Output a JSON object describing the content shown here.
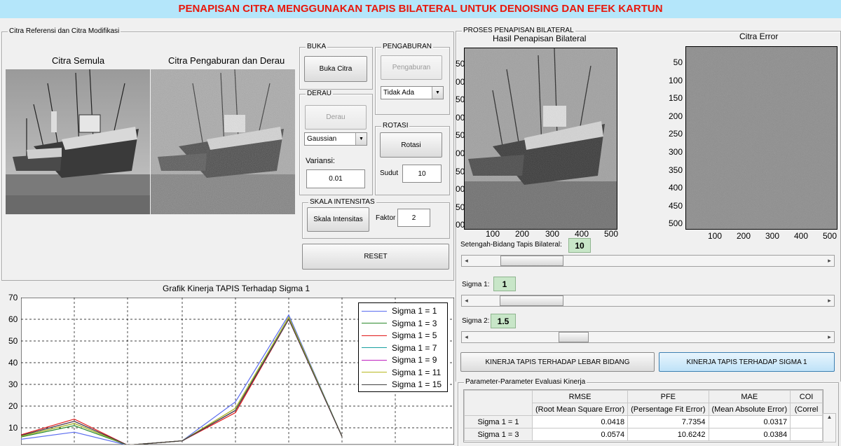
{
  "title": "PENAPISAN CITRA MENGGUNAKAN TAPIS BILATERAL UNTUK DENOISING DAN EFEK KARTUN",
  "left_panel": {
    "title": "Citra Referensi dan Citra Modifikasi",
    "original_label": "Citra Semula",
    "modified_label": "Citra Pengaburan dan Derau"
  },
  "buka": {
    "title": "BUKA",
    "button": "Buka Citra"
  },
  "pengaburan": {
    "title": "PENGABURAN",
    "button": "Pengaburan",
    "select": "Tidak Ada"
  },
  "derau": {
    "title": "DERAU",
    "button": "Derau",
    "select": "Gaussian",
    "variance_label": "Variansi:",
    "variance_value": "0.01"
  },
  "rotasi": {
    "title": "ROTASI",
    "button": "Rotasi",
    "angle_label": "Sudut",
    "angle_value": "10"
  },
  "skala": {
    "title": "SKALA INTENSITAS",
    "button": "Skala Intensitas",
    "factor_label": "Faktor",
    "factor_value": "2"
  },
  "reset": "RESET",
  "bottom_chart": {
    "title": "Grafik Kinerja TAPIS Terhadap Sigma 1",
    "yticks": [
      "70",
      "60",
      "50",
      "40",
      "30",
      "20",
      "10"
    ]
  },
  "chart_data": {
    "type": "line",
    "title": "Grafik Kinerja TAPIS Terhadap Sigma 1",
    "ylim": [
      0,
      70
    ],
    "grid": true,
    "legend_position": "top-right",
    "x": [
      1,
      2,
      3,
      4,
      5,
      6,
      7
    ],
    "series": [
      {
        "name": "Sigma 1 = 1",
        "color": "#5a6cf0",
        "values": [
          3,
          8,
          2,
          4,
          22,
          62,
          6
        ]
      },
      {
        "name": "Sigma 1 = 3",
        "color": "#2a8a2a",
        "values": [
          3,
          11,
          2,
          4,
          19,
          61,
          6
        ]
      },
      {
        "name": "Sigma 1 = 5",
        "color": "#e01818",
        "values": [
          3,
          14,
          2,
          4,
          17,
          60,
          6
        ]
      },
      {
        "name": "Sigma 1 = 7",
        "color": "#18a0a0",
        "values": [
          3,
          12,
          2,
          4,
          18,
          61,
          6
        ]
      },
      {
        "name": "Sigma 1 = 9",
        "color": "#c020c0",
        "values": [
          3,
          13,
          2,
          4,
          18,
          60,
          6
        ]
      },
      {
        "name": "Sigma 1 = 11",
        "color": "#b8b820",
        "values": [
          3,
          12,
          2,
          4,
          19,
          61,
          6
        ]
      },
      {
        "name": "Sigma 1 = 15",
        "color": "#404040",
        "values": [
          3,
          13,
          2,
          4,
          18,
          60,
          6
        ]
      }
    ]
  },
  "right_panel": {
    "title": "PROSES PENAPISAN BILATERAL",
    "filtered_title": "Hasil Penapisan Bilateral",
    "error_title": "Citra Error",
    "x_ticks": [
      "100",
      "200",
      "300",
      "400",
      "500"
    ],
    "error_y_ticks": [
      "50",
      "100",
      "150",
      "200",
      "250",
      "300",
      "350",
      "400",
      "450",
      "500"
    ],
    "filtered_y_ticks": [
      "50",
      "00",
      "50",
      "00",
      "50",
      "00",
      "50",
      "00",
      "50",
      "00"
    ]
  },
  "controls": {
    "halfwidth_label": "Setengah-Bidang Tapis Bilateral:",
    "halfwidth_value": "10",
    "sigma1_label": "Sigma 1:",
    "sigma1_value": "1",
    "sigma2_label": "Sigma 2:",
    "sigma2_value": "1.5",
    "slider_halfwidth": 0.1,
    "slider_sigma1": 0.1,
    "slider_sigma2": 0.27,
    "btn_lebar": "KINERJA TAPIS TERHADAP LEBAR BIDANG",
    "btn_sigma": "KINERJA TAPIS TERHADAP SIGMA 1"
  },
  "eval": {
    "title": "Parameter-Parameter Evaluasi Kinerja",
    "headers": [
      {
        "short": "RMSE",
        "long": "(Root Mean Square Error)"
      },
      {
        "short": "PFE",
        "long": "(Persentage Fit Error)"
      },
      {
        "short": "MAE",
        "long": "(Mean Absolute Error)"
      },
      {
        "short": "COI",
        "long": "(Correl"
      }
    ],
    "rows": [
      {
        "label": "Sigma 1 = 1",
        "rmse": "0.0418",
        "pfe": "7.7354",
        "mae": "0.0317"
      },
      {
        "label": "Sigma 1 = 3",
        "rmse": "0.0574",
        "pfe": "10.6242",
        "mae": "0.0384"
      }
    ]
  }
}
